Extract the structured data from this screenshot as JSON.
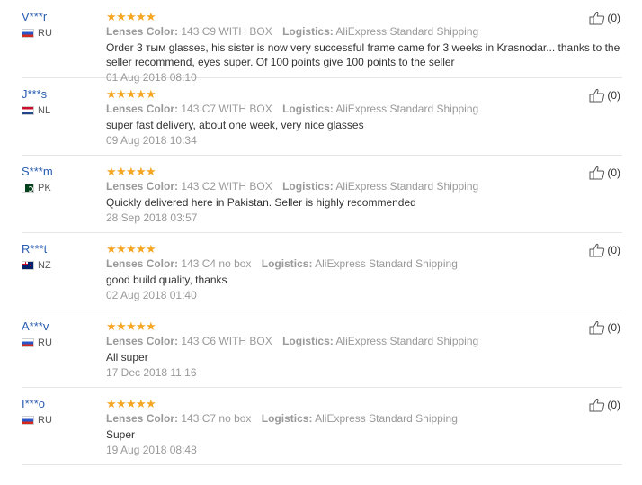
{
  "reviews": [
    {
      "user": "V***r",
      "country": "RU",
      "flag": "ru",
      "stars": 5,
      "color_label": "Lenses Color:",
      "color_value": "143 C9 WITH BOX",
      "logistics_label": "Logistics:",
      "logistics_value": "AliExpress Standard Shipping",
      "comment": "Order 3 тым glasses, his sister is now very successful frame came for 3 weeks in Krasnodar... thanks to the seller recommend, eyes super. Of 100 points give 100 points to the seller",
      "date": "01 Aug 2018 08:10",
      "helpful": "(0)"
    },
    {
      "user": "J***s",
      "country": "NL",
      "flag": "nl",
      "stars": 5,
      "color_label": "Lenses Color:",
      "color_value": "143 C7 WITH BOX",
      "logistics_label": "Logistics:",
      "logistics_value": "AliExpress Standard Shipping",
      "comment": "super fast delivery, about one week, very nice glasses",
      "date": "09 Aug 2018 10:34",
      "helpful": "(0)"
    },
    {
      "user": "S***m",
      "country": "PK",
      "flag": "pk",
      "stars": 5,
      "color_label": "Lenses Color:",
      "color_value": "143 C2 WITH BOX",
      "logistics_label": "Logistics:",
      "logistics_value": "AliExpress Standard Shipping",
      "comment": "Quickly delivered here in Pakistan. Seller is highly recommended",
      "date": "28 Sep 2018 03:57",
      "helpful": "(0)"
    },
    {
      "user": "R***t",
      "country": "NZ",
      "flag": "nz",
      "stars": 5,
      "color_label": "Lenses Color:",
      "color_value": "143 C4 no box",
      "logistics_label": "Logistics:",
      "logistics_value": "AliExpress Standard Shipping",
      "comment": "good build quality, thanks",
      "date": "02 Aug 2018 01:40",
      "helpful": "(0)"
    },
    {
      "user": "A***v",
      "country": "RU",
      "flag": "ru",
      "stars": 5,
      "color_label": "Lenses Color:",
      "color_value": "143 C6 WITH BOX",
      "logistics_label": "Logistics:",
      "logistics_value": "AliExpress Standard Shipping",
      "comment": "All super",
      "date": "17 Dec 2018 11:16",
      "helpful": "(0)"
    },
    {
      "user": "I***o",
      "country": "RU",
      "flag": "ru",
      "stars": 5,
      "color_label": "Lenses Color:",
      "color_value": "143 C7 no box",
      "logistics_label": "Logistics:",
      "logistics_value": "AliExpress Standard Shipping",
      "comment": "Super",
      "date": "19 Aug 2018 08:48",
      "helpful": "(0)"
    }
  ],
  "icons": {
    "star": "star-icon",
    "helpful": "thumbs-up-icon"
  },
  "colors": {
    "user_link": "#2a5db0",
    "star": "#f5a623",
    "meta": "#999999",
    "text": "#333333"
  }
}
